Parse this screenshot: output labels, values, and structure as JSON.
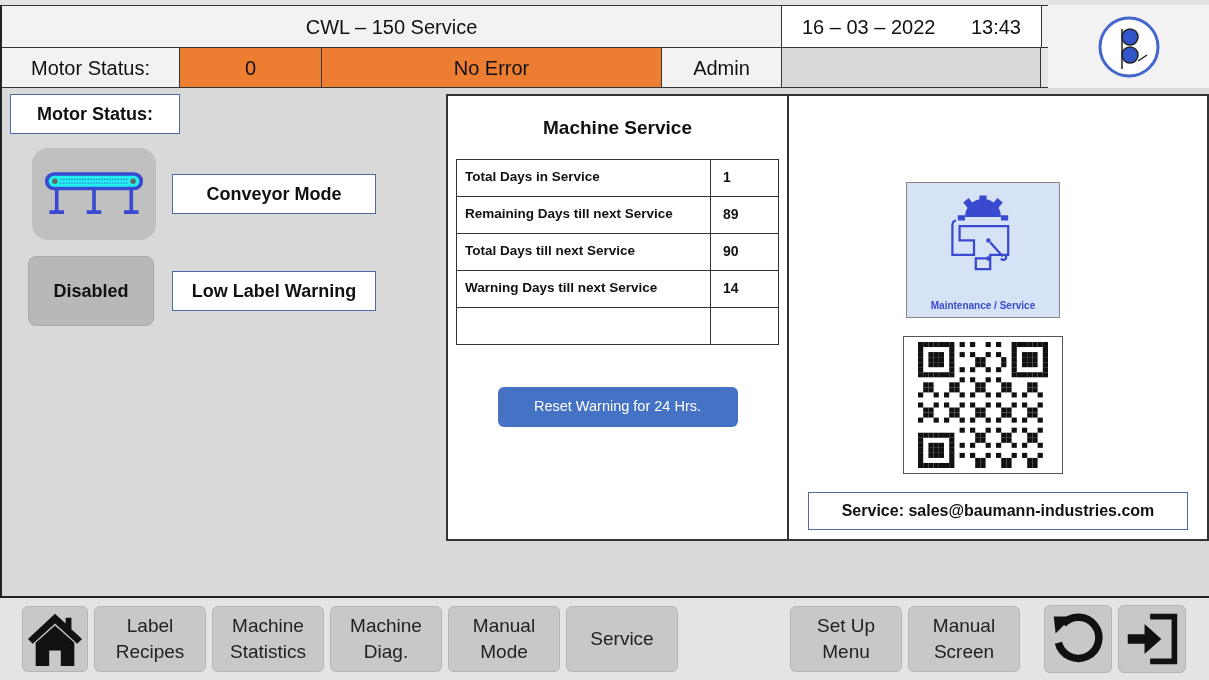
{
  "header": {
    "title": "CWL – 150 Service",
    "date": "16 – 03 – 2022",
    "time": "13:43"
  },
  "status_bar": {
    "label": "Motor Status:",
    "code": "0",
    "message": "No Error",
    "user": "Admin"
  },
  "left_panel": {
    "heading": "Motor Status:",
    "mode_label": "Conveyor Mode",
    "warning_button": "Disabled",
    "warning_label": "Low Label Warning"
  },
  "machine_service": {
    "title": "Machine Service",
    "rows": [
      {
        "label": "Total Days in Service",
        "value": "1"
      },
      {
        "label": "Remaining Days till next Service",
        "value": "89"
      },
      {
        "label": "Total Days till next Service",
        "value": "90"
      },
      {
        "label": "Warning Days till next Service",
        "value": "14"
      }
    ],
    "reset_button": "Reset Warning for 24 Hrs."
  },
  "service_panel": {
    "tile_caption": "Maintenance / Service",
    "contact": "Service: sales@baumann-industries.com"
  },
  "nav": {
    "left": [
      "Label\nRecipes",
      "Machine\nStatistics",
      "Machine\nDiag.",
      "Manual\nMode",
      "Service"
    ],
    "right": [
      "Set Up\nMenu",
      "Manual\nScreen"
    ]
  }
}
